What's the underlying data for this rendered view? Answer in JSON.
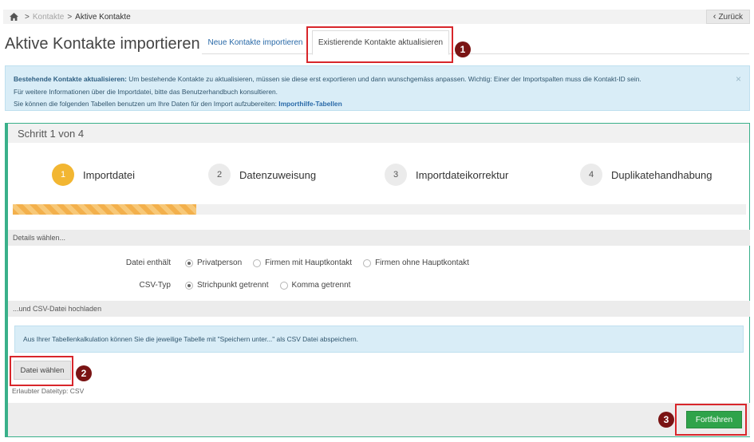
{
  "breadcrumb": {
    "parent": "Kontakte",
    "current": "Aktive Kontakte"
  },
  "back_label": "Zurück",
  "page_title": "Aktive Kontakte importieren",
  "tabs": [
    {
      "label": "Neue Kontakte importieren",
      "active": false
    },
    {
      "label": "Existierende Kontakte aktualisieren",
      "active": true
    }
  ],
  "info": {
    "strong": "Bestehende Kontakte aktualisieren:",
    "line1": " Um bestehende Kontakte zu aktualisieren, müssen sie diese erst exportieren und dann wunschgemäss anpassen. Wichtig: Einer der Importspalten muss die Kontakt-ID sein.",
    "line2": "Für weitere Informationen über die Importdatei, bitte das Benutzerhandbuch konsultieren.",
    "line3": "Sie können die folgenden Tabellen benutzen um Ihre Daten für den Import aufzubereiten: ",
    "link": "Importhilfe-Tabellen",
    "close": "×"
  },
  "wizard": {
    "header": "Schritt 1 von 4",
    "steps": [
      {
        "num": "1",
        "label": "Importdatei",
        "active": true
      },
      {
        "num": "2",
        "label": "Datenzuweisung",
        "active": false
      },
      {
        "num": "3",
        "label": "Importdateikorrektur",
        "active": false
      },
      {
        "num": "4",
        "label": "Duplikatehandhabung",
        "active": false
      }
    ],
    "progress_fraction": 0.25,
    "section_details": "Details wählen...",
    "file_contains": {
      "label": "Datei enthält",
      "options": [
        "Privatperson",
        "Firmen mit Hauptkontakt",
        "Firmen ohne Hauptkontakt"
      ],
      "selected": "Privatperson"
    },
    "csv_type": {
      "label": "CSV-Typ",
      "options": [
        "Strichpunkt getrennt",
        "Komma getrennt"
      ],
      "selected": "Strichpunkt getrennt"
    },
    "section_upload": "...und CSV-Datei hochladen",
    "hint": "Aus Ihrer Tabellenkalkulation können Sie die jeweilige Tabelle mit \"Speichern unter...\" als CSV Datei abspeichern.",
    "file_button": "Datei wählen",
    "file_note": "Erlaubter Dateityp: CSV",
    "continue": "Fortfahren"
  },
  "annotations": [
    "1",
    "2",
    "3"
  ],
  "colors": {
    "accent": "#39b08a",
    "active_step": "#f2b632",
    "continue": "#2fa34a",
    "annotation": "#d8262b"
  }
}
